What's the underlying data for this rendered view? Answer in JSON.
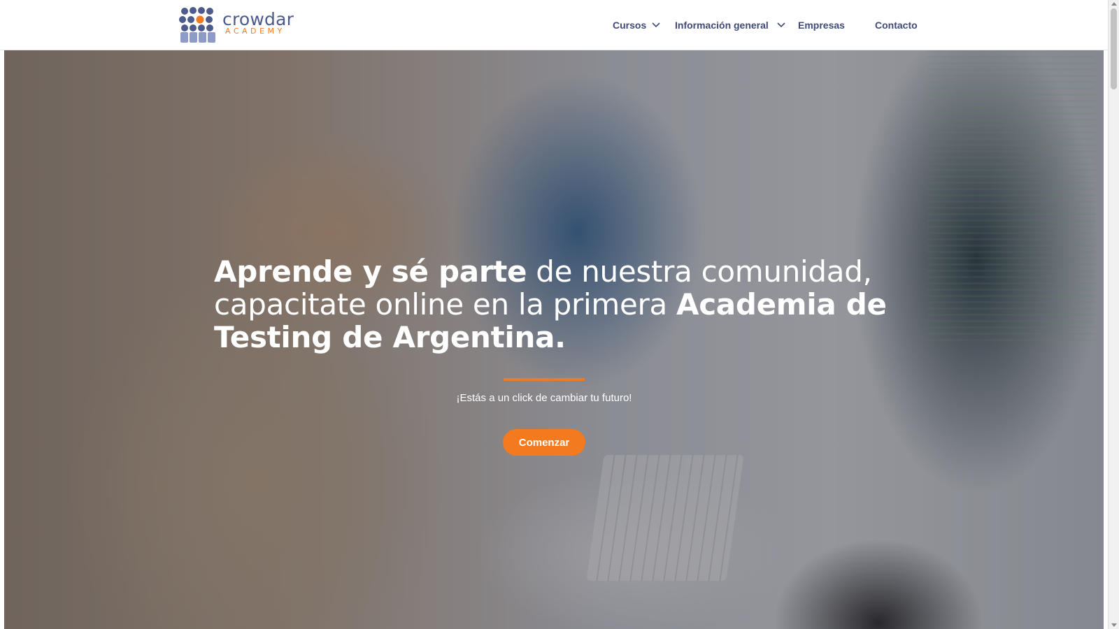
{
  "brand": {
    "name": "crowdar",
    "sub": "ACADEMY",
    "icon": "crowd-people-icon",
    "colors": {
      "primary": "#4c5a8c",
      "accent": "#f47a20"
    }
  },
  "nav": {
    "items": [
      {
        "label": "Cursos",
        "dropdown": true
      },
      {
        "label": "Información general",
        "dropdown": true
      },
      {
        "label": "Empresas",
        "dropdown": false
      },
      {
        "label": "Contacto",
        "dropdown": false
      }
    ]
  },
  "hero": {
    "headline": {
      "bold1": "Aprende y sé parte",
      "normal1": " de nuestra comunidad, capacitate online en la primera ",
      "bold2": "Academia de Testing de Argentina."
    },
    "tagline": "¡Estás a un click de cambiar tu futuro!",
    "cta_label": "Comenzar",
    "accent_color": "#f47a20"
  }
}
